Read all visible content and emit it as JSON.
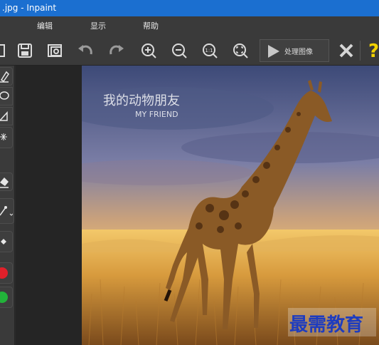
{
  "window": {
    "title": ".jpg - Inpaint"
  },
  "menu": {
    "items": [
      "编辑",
      "显示",
      "帮助"
    ]
  },
  "toolbar": {
    "process_label": "处理图像",
    "icons": [
      "open-icon",
      "save-icon",
      "save-as-icon",
      "undo-icon",
      "redo-icon",
      "zoom-in-icon",
      "zoom-out-icon",
      "actual-size-icon",
      "fit-icon",
      "play-icon",
      "close-icon",
      "help-icon"
    ]
  },
  "left_tools": [
    "marker-icon",
    "lasso-icon",
    "polygon-icon",
    "magic-wand-icon",
    "eraser-icon",
    "guide-lines-icon",
    "move-icon",
    "red-dot",
    "green-dot"
  ],
  "image": {
    "watermark_cn": "我的动物朋友",
    "watermark_en": "MY FRIEND",
    "brand": "最需教育"
  },
  "colors": {
    "titlebar": "#1b6fd0",
    "help": "#f2d200",
    "red": "#e0202a",
    "green": "#22b33a",
    "brand_blue": "#1e3cbf"
  }
}
